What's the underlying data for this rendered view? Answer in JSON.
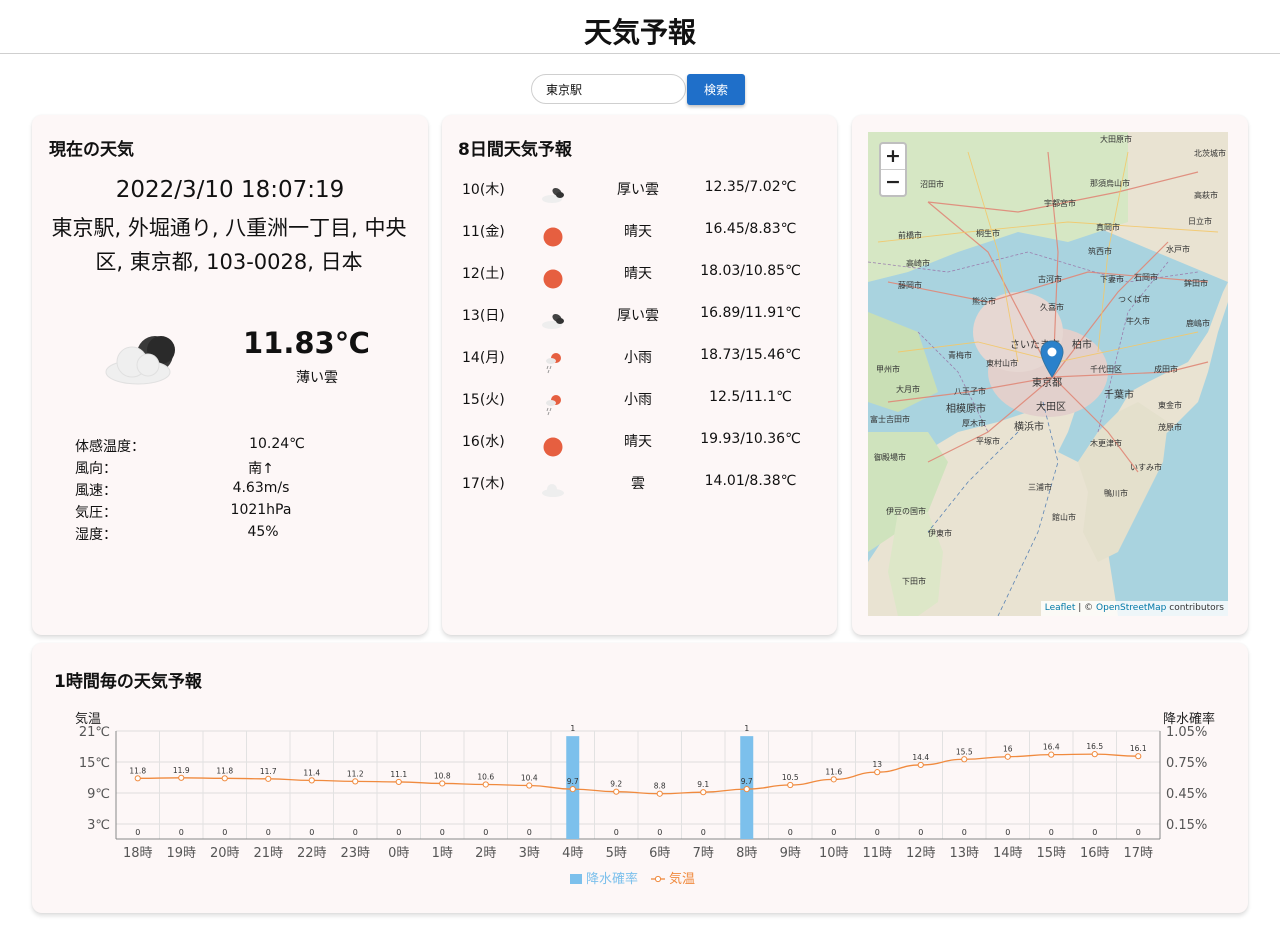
{
  "header": {
    "title": "天気予報"
  },
  "search": {
    "value": "東京駅",
    "button_label": "検索"
  },
  "current": {
    "title": "現在の天気",
    "datetime": "2022/3/10 18:07:19",
    "address": "東京駅, 外堀通り, 八重洲一丁目, 中央区, 東京都, 103-0028, 日本",
    "icon": "night-cloudy-icon",
    "temperature": "11.83℃",
    "description": "薄い雲",
    "details": [
      {
        "label": "体感温度：",
        "value": "10.24℃"
      },
      {
        "label": "風向：",
        "value": "南↑"
      },
      {
        "label": "風速：",
        "value": "4.63m/s"
      },
      {
        "label": "気圧：",
        "value": "1021hPa"
      },
      {
        "label": "湿度：",
        "value": "45%"
      }
    ]
  },
  "forecast": {
    "title": "8日間天気予報",
    "days": [
      {
        "day": "10(木)",
        "icon": "broken-clouds-icon",
        "desc": "厚い雲",
        "temp": "12.35/7.02℃"
      },
      {
        "day": "11(金)",
        "icon": "sun-icon",
        "desc": "晴天",
        "temp": "16.45/8.83℃"
      },
      {
        "day": "12(土)",
        "icon": "sun-icon",
        "desc": "晴天",
        "temp": "18.03/10.85℃"
      },
      {
        "day": "13(日)",
        "icon": "broken-clouds-icon",
        "desc": "厚い雲",
        "temp": "16.89/11.91℃"
      },
      {
        "day": "14(月)",
        "icon": "light-rain-icon",
        "desc": "小雨",
        "temp": "18.73/15.46℃"
      },
      {
        "day": "15(火)",
        "icon": "light-rain-icon",
        "desc": "小雨",
        "temp": "12.5/11.1℃"
      },
      {
        "day": "16(水)",
        "icon": "sun-icon",
        "desc": "晴天",
        "temp": "19.93/10.36℃"
      },
      {
        "day": "17(木)",
        "icon": "cloud-icon",
        "desc": "雲",
        "temp": "14.01/8.38℃"
      }
    ]
  },
  "map": {
    "zoom_in": "+",
    "zoom_out": "−",
    "attribution_leaflet": "Leaflet",
    "attribution_sep": " | © ",
    "attribution_osm": "OpenStreetMap",
    "attribution_tail": " contributors",
    "marker": "map-marker-icon",
    "place_labels": [
      "大田原市",
      "北茨城市",
      "那須烏山市",
      "沼田市",
      "宇都宮市",
      "高萩市",
      "日立市",
      "前橋市",
      "桐生市",
      "真岡市",
      "筑西市",
      "水戸市",
      "高崎市",
      "藤岡市",
      "古河市",
      "下妻市",
      "石岡市",
      "鉾田市",
      "熊谷市",
      "久喜市",
      "つくば市",
      "鹿嶋市",
      "さいたま市",
      "柏市",
      "牛久市",
      "青梅市",
      "東村山市",
      "東京都",
      "千代田区",
      "成田市",
      "甲州市",
      "大月市",
      "八王子市",
      "大田区",
      "千葉市",
      "東金市",
      "相模原市",
      "横浜市",
      "富士吉田市",
      "厚木市",
      "茂原市",
      "平塚市",
      "木更津市",
      "御殿場市",
      "いすみ市",
      "三浦市",
      "鴨川市",
      "伊豆の国市",
      "館山市",
      "伊東市",
      "下田市"
    ]
  },
  "hourly": {
    "title": "1時間毎の天気予報"
  },
  "chart_data": {
    "type": "bar+line",
    "categories": [
      "18時",
      "19時",
      "20時",
      "21時",
      "22時",
      "23時",
      "0時",
      "1時",
      "2時",
      "3時",
      "4時",
      "5時",
      "6時",
      "7時",
      "8時",
      "9時",
      "10時",
      "11時",
      "12時",
      "13時",
      "14時",
      "15時",
      "16時",
      "17時"
    ],
    "series": [
      {
        "name": "降水確率",
        "type": "bar",
        "axis": "right",
        "color": "#7cc0ec",
        "values": [
          0,
          0,
          0,
          0,
          0,
          0,
          0,
          0,
          0,
          0,
          1,
          0,
          0,
          0,
          1,
          0,
          0,
          0,
          0,
          0,
          0,
          0,
          0,
          0
        ]
      },
      {
        "name": "気温",
        "type": "line",
        "axis": "left",
        "color": "#f08a3e",
        "values": [
          11.8,
          11.9,
          11.8,
          11.7,
          11.4,
          11.2,
          11.1,
          10.8,
          10.6,
          10.4,
          9.7,
          9.2,
          8.8,
          9.1,
          9.7,
          10.5,
          11.6,
          13,
          14.4,
          15.5,
          16,
          16.4,
          16.5,
          16.1
        ]
      }
    ],
    "ylabel_left": "気温",
    "ylabel_right": "降水確率",
    "left_ticks": [
      "21℃",
      "15℃",
      "9℃",
      "3℃"
    ],
    "right_ticks": [
      "1.05%",
      "0.75%",
      "0.45%",
      "0.15%"
    ],
    "ylim_left": [
      0,
      21
    ],
    "ylim_right": [
      0,
      1.05
    ],
    "grid": true,
    "legend_position": "bottom"
  }
}
